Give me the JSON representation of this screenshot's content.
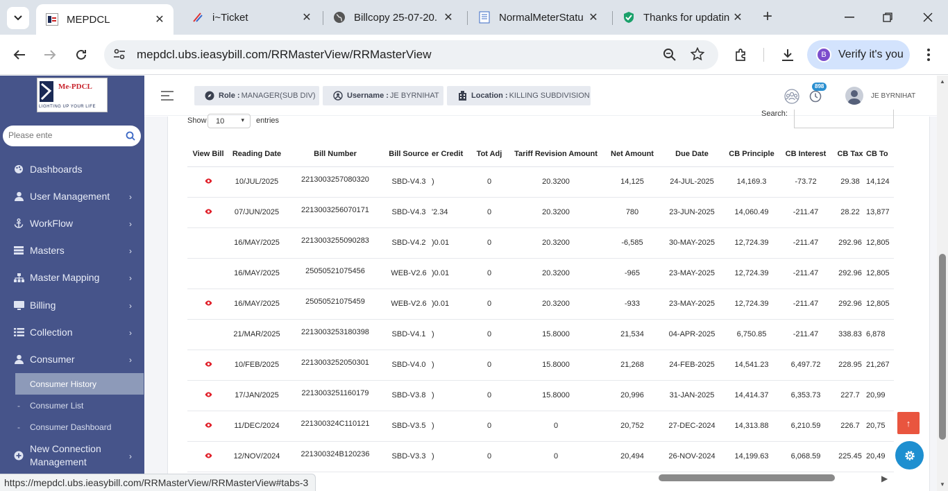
{
  "browser": {
    "tabs": [
      {
        "title": "MEPDCL",
        "icon": "mepdcl-favicon",
        "active": true
      },
      {
        "title": "i~Ticket",
        "icon": "iticket-favicon",
        "active": false
      },
      {
        "title": "Billcopy 25-07-20.",
        "icon": "globe-favicon",
        "active": false
      },
      {
        "title": "NormalMeterStatu",
        "icon": "document-favicon",
        "active": false
      },
      {
        "title": "Thanks for updatin",
        "icon": "shield-favicon",
        "active": false
      }
    ],
    "url": "mepdcl.ubs.ieasybill.com/RRMasterView/RRMasterView",
    "verify_label": "Verify it's you",
    "profile_initial": "B",
    "status_url": "https://mepdcl.ubs.ieasybill.com/RRMasterView/RRMasterView#tabs-3"
  },
  "sidebar": {
    "logo_text": "Me-PDCL",
    "logo_tagline": "LIGHTING UP YOUR LIFE",
    "search_placeholder": "Please ente",
    "items": [
      {
        "label": "Dashboards",
        "icon": "palette-icon",
        "has_children": false
      },
      {
        "label": "User Management",
        "icon": "user-icon",
        "has_children": true
      },
      {
        "label": "WorkFlow",
        "icon": "anchor-icon",
        "has_children": true
      },
      {
        "label": "Masters",
        "icon": "list-icon",
        "has_children": true
      },
      {
        "label": "Master Mapping",
        "icon": "sitemap-icon",
        "has_children": true
      },
      {
        "label": "Billing",
        "icon": "monitor-icon",
        "has_children": true
      },
      {
        "label": "Collection",
        "icon": "list-ul-icon",
        "has_children": true
      },
      {
        "label": "Consumer",
        "icon": "user-icon",
        "has_children": true
      }
    ],
    "sub_items": [
      {
        "label": "Consumer History",
        "active": true
      },
      {
        "label": "Consumer List",
        "active": false
      },
      {
        "label": "Consumer Dashboard",
        "active": false
      }
    ],
    "last_item": {
      "label_line1": "New Connection",
      "label_line2": "Management",
      "icon": "plus-circle-icon"
    }
  },
  "header": {
    "role_key": "Role :",
    "role_value": "MANAGER(SUB DIV)",
    "username_key": "Username :",
    "username_value": "JE BYRNIHAT",
    "location_key": "Location :",
    "location_value": "KILLING SUBDIVISION",
    "notification_count": "898",
    "user_display": "JE BYRNIHAT"
  },
  "table_controls": {
    "show_label": "Show",
    "page_size": "10",
    "entries_label": "entries",
    "search_label": "Search:"
  },
  "table": {
    "columns": [
      "View Bill",
      "Reading Date",
      "Bill Number",
      "Bill Source",
      "er Credit",
      "Tot Adj",
      "Tariff Revision Amount",
      "Net Amount",
      "Due Date",
      "CB Principle",
      "CB Interest",
      "CB Tax",
      "CB To"
    ],
    "rows": [
      {
        "view": true,
        "reading_date": "10/JUL/2025",
        "bill_number": "2213003257080320",
        "bill_source": "SBD-V4.3",
        "credit": ")",
        "tot_adj": "0",
        "tariff_rev": "20.3200",
        "net_amount": "14,125",
        "due_date": "24-JUL-2025",
        "cb_principle": "14,169.3",
        "cb_interest": "-73.72",
        "cb_tax": "29.38",
        "cb_total": "14,124"
      },
      {
        "view": true,
        "reading_date": "07/JUN/2025",
        "bill_number": "2213003256070171",
        "bill_source": "SBD-V4.3",
        "credit": "'2.34",
        "tot_adj": "0",
        "tariff_rev": "20.3200",
        "net_amount": "780",
        "due_date": "23-JUN-2025",
        "cb_principle": "14,060.49",
        "cb_interest": "-211.47",
        "cb_tax": "28.22",
        "cb_total": "13,877"
      },
      {
        "view": false,
        "reading_date": "16/MAY/2025",
        "bill_number": "2213003255090283",
        "bill_source": "SBD-V4.2",
        "credit": ")0.01",
        "tot_adj": "0",
        "tariff_rev": "20.3200",
        "net_amount": "-6,585",
        "due_date": "30-MAY-2025",
        "cb_principle": "12,724.39",
        "cb_interest": "-211.47",
        "cb_tax": "292.96",
        "cb_total": "12,805"
      },
      {
        "view": false,
        "reading_date": "16/MAY/2025",
        "bill_number": "25050521075456",
        "bill_source": "WEB-V2.6",
        "credit": ")0.01",
        "tot_adj": "0",
        "tariff_rev": "20.3200",
        "net_amount": "-965",
        "due_date": "23-MAY-2025",
        "cb_principle": "12,724.39",
        "cb_interest": "-211.47",
        "cb_tax": "292.96",
        "cb_total": "12,805"
      },
      {
        "view": true,
        "reading_date": "16/MAY/2025",
        "bill_number": "25050521075459",
        "bill_source": "WEB-V2.6",
        "credit": ")0.01",
        "tot_adj": "0",
        "tariff_rev": "20.3200",
        "net_amount": "-933",
        "due_date": "23-MAY-2025",
        "cb_principle": "12,724.39",
        "cb_interest": "-211.47",
        "cb_tax": "292.96",
        "cb_total": "12,805"
      },
      {
        "view": false,
        "reading_date": "21/MAR/2025",
        "bill_number": "2213003253180398",
        "bill_source": "SBD-V4.1",
        "credit": ")",
        "tot_adj": "0",
        "tariff_rev": "15.8000",
        "net_amount": "21,534",
        "due_date": "04-APR-2025",
        "cb_principle": "6,750.85",
        "cb_interest": "-211.47",
        "cb_tax": "338.83",
        "cb_total": "6,878"
      },
      {
        "view": true,
        "reading_date": "10/FEB/2025",
        "bill_number": "2213003252050301",
        "bill_source": "SBD-V4.0",
        "credit": ")",
        "tot_adj": "0",
        "tariff_rev": "15.8000",
        "net_amount": "21,268",
        "due_date": "24-FEB-2025",
        "cb_principle": "14,541.23",
        "cb_interest": "6,497.72",
        "cb_tax": "228.95",
        "cb_total": "21,267"
      },
      {
        "view": true,
        "reading_date": "17/JAN/2025",
        "bill_number": "2213003251160179",
        "bill_source": "SBD-V3.8",
        "credit": ")",
        "tot_adj": "0",
        "tariff_rev": "15.8000",
        "net_amount": "20,996",
        "due_date": "31-JAN-2025",
        "cb_principle": "14,414.37",
        "cb_interest": "6,353.73",
        "cb_tax": "227.7",
        "cb_total": "20,99"
      },
      {
        "view": true,
        "reading_date": "11/DEC/2024",
        "bill_number": "221300324C110121",
        "bill_source": "SBD-V3.5",
        "credit": ")",
        "tot_adj": "0",
        "tariff_rev": "0",
        "net_amount": "20,752",
        "due_date": "27-DEC-2024",
        "cb_principle": "14,313.88",
        "cb_interest": "6,210.59",
        "cb_tax": "226.7",
        "cb_total": "20,75"
      },
      {
        "view": true,
        "reading_date": "12/NOV/2024",
        "bill_number": "221300324B120236",
        "bill_source": "SBD-V3.3",
        "credit": ")",
        "tot_adj": "0",
        "tariff_rev": "0",
        "net_amount": "20,494",
        "due_date": "26-NOV-2024",
        "cb_principle": "14,199.63",
        "cb_interest": "6,068.59",
        "cb_tax": "225.45",
        "cb_total": "20,49"
      }
    ]
  },
  "colors": {
    "sidebar_bg": "#46548a",
    "eye_icon": "#e0202a",
    "scroll_top_button": "#e9553f",
    "settings_button": "#1e8fd0",
    "badge": "#2a8fd0"
  }
}
